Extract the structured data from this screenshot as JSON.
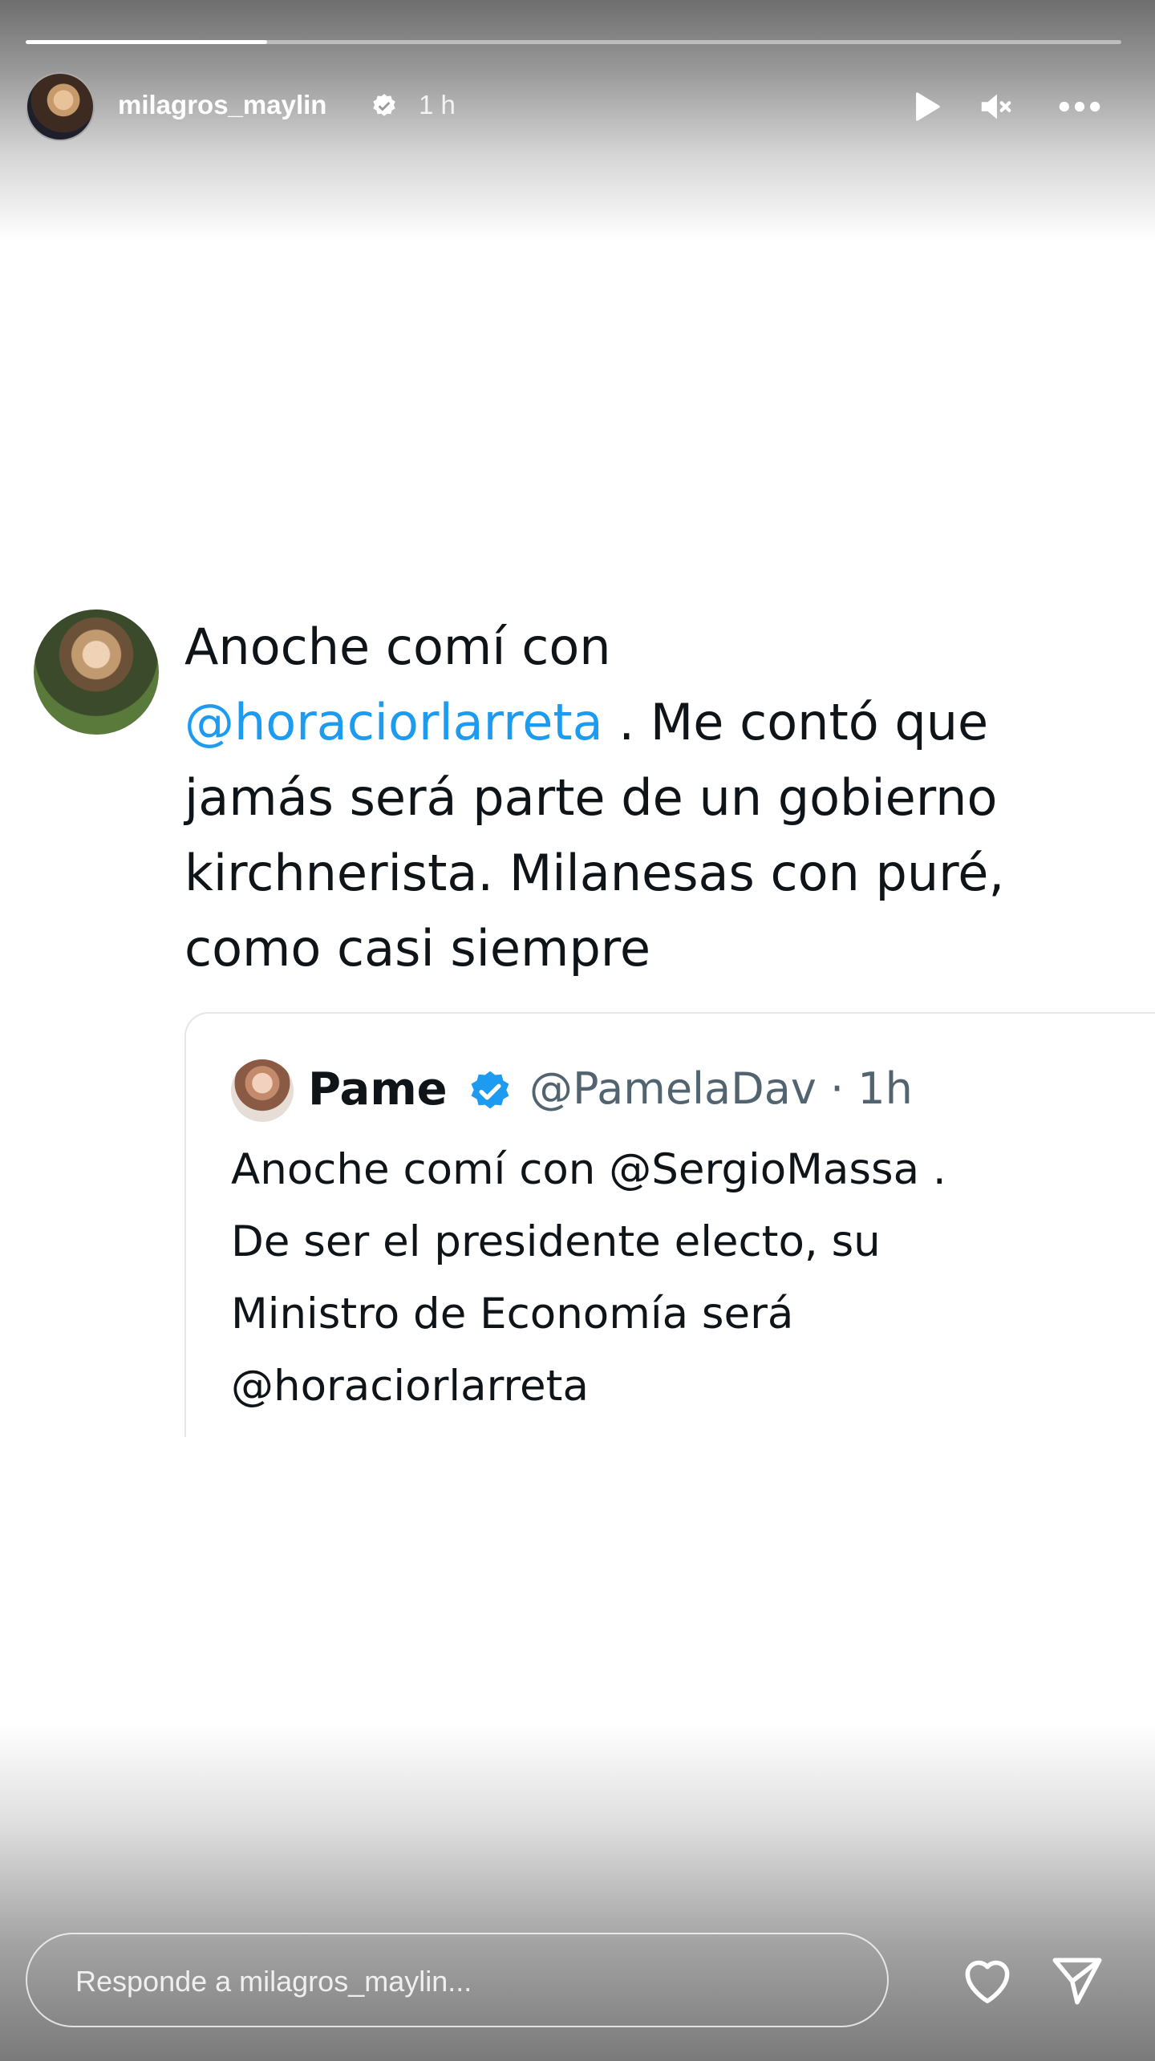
{
  "story": {
    "progress": 0.22,
    "username": "milagros_maylin",
    "time": "1 h",
    "controls": [
      "play-icon",
      "muted-speaker-icon",
      "more-options-icon"
    ]
  },
  "tweet": {
    "line1": "Anoche comí con",
    "mention": "@horaciorlarreta",
    "line2_rest": " . Me contó que",
    "line3": "jamás será parte de un gobierno",
    "line4": "kirchnerista. Milanesas con puré,",
    "line5": "como casi siempre"
  },
  "quoted_tweet": {
    "name": "Pame",
    "handle_time": "@PamelaDav · 1h",
    "line1": "Anoche comí con @SergioMassa .",
    "line2": "De ser el presidente electo, su",
    "line3": "Ministro de Economía será",
    "line4": "@horaciorlarreta"
  },
  "reply": {
    "placeholder": "Responde a milagros_maylin..."
  },
  "colors": {
    "mention": "#1d9bf0",
    "verified": "#1d9bf0",
    "text": "#0f1419",
    "handle": "#536471"
  }
}
